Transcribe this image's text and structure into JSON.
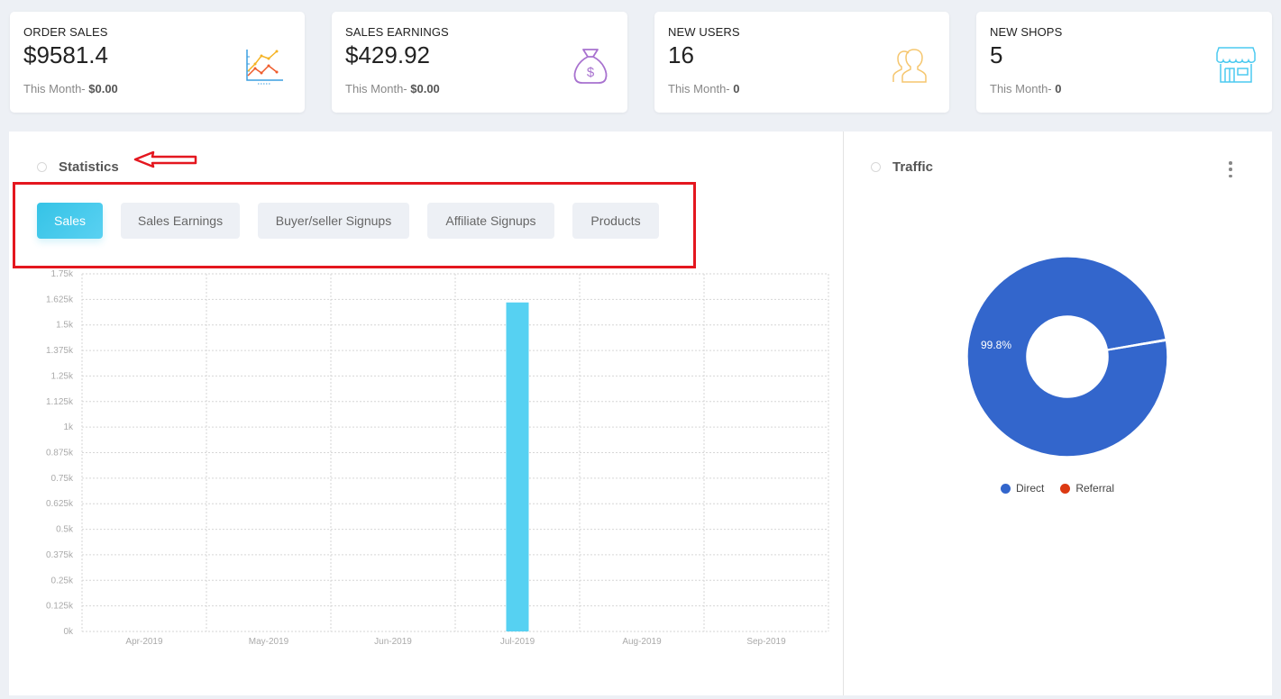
{
  "stats_cards": [
    {
      "title": "ORDER SALES",
      "value": "$9581.4",
      "sub_label": "This Month- ",
      "sub_value": "$0.00",
      "icon": "line-chart-icon"
    },
    {
      "title": "SALES EARNINGS",
      "value": "$429.92",
      "sub_label": "This Month- ",
      "sub_value": "$0.00",
      "icon": "money-bag-icon"
    },
    {
      "title": "NEW USERS",
      "value": "16",
      "sub_label": "This Month- ",
      "sub_value": "0",
      "icon": "users-icon"
    },
    {
      "title": "NEW SHOPS",
      "value": "5",
      "sub_label": "This Month- ",
      "sub_value": "0",
      "icon": "shop-icon"
    }
  ],
  "statistics": {
    "title": "Statistics",
    "tabs": [
      {
        "label": "Sales",
        "active": true
      },
      {
        "label": "Sales Earnings",
        "active": false
      },
      {
        "label": "Buyer/seller Signups",
        "active": false
      },
      {
        "label": "Affiliate Signups",
        "active": false
      },
      {
        "label": "Products",
        "active": false
      }
    ]
  },
  "traffic": {
    "title": "Traffic"
  },
  "colors": {
    "accent": "#35c3e6",
    "bar": "#56d1f2",
    "direct": "#3366cc",
    "referral": "#dc3912",
    "annotation": "#e4171f"
  },
  "chart_data": [
    {
      "type": "bar",
      "title": "Sales",
      "categories": [
        "Apr-2019",
        "May-2019",
        "Jun-2019",
        "Jul-2019",
        "Aug-2019",
        "Sep-2019"
      ],
      "values": [
        0,
        0,
        0,
        1610,
        0,
        0
      ],
      "ylim": [
        0,
        1750
      ],
      "yticks": [
        "0k",
        "0.125k",
        "0.25k",
        "0.375k",
        "0.5k",
        "0.625k",
        "0.75k",
        "0.875k",
        "1k",
        "1.125k",
        "1.25k",
        "1.375k",
        "1.5k",
        "1.625k",
        "1.75k"
      ],
      "xlabel": "",
      "ylabel": "",
      "grid": true
    },
    {
      "type": "pie",
      "title": "Traffic",
      "donut": true,
      "categories": [
        "Direct",
        "Referral"
      ],
      "values": [
        99.8,
        0.2
      ],
      "data_labels": [
        "99.8%",
        ""
      ],
      "legend": "bottom"
    }
  ]
}
